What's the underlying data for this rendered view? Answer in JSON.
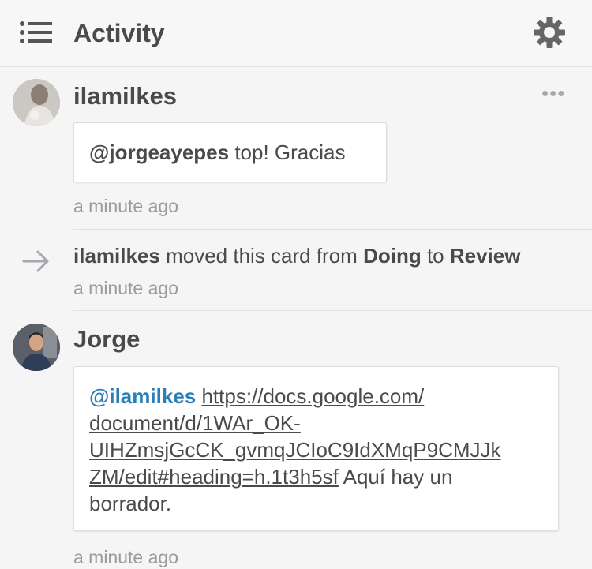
{
  "header": {
    "title": "Activity",
    "menu_icon": "list-menu-icon",
    "settings_icon": "gear-icon"
  },
  "activities": [
    {
      "user": "ilamilkes",
      "mention": "@jorgeayepes",
      "text": " top! Gracias",
      "time": "a minute ago"
    },
    {
      "user": "ilamilkes",
      "action": " moved this card from ",
      "from": "Doing",
      "to_word": " to ",
      "to": "Review",
      "time": "a minute ago"
    },
    {
      "user": "Jorge",
      "mention": "@ilamilkes",
      "url_lines": [
        "https://docs.google.com/",
        "document/d/1WAr_OK-",
        "UIHZmsjGcCK_gvmqJCIoC9IdXMqP9CMJJk",
        "ZM/edit#heading=h.1t3h5sf"
      ],
      "text_after": " Aquí hay un",
      "text_end": "borrador.",
      "time": "a minute ago"
    }
  ],
  "colors": {
    "link": "#2a7fb8",
    "text": "#4a4a4a",
    "muted": "#9a9aa0"
  }
}
